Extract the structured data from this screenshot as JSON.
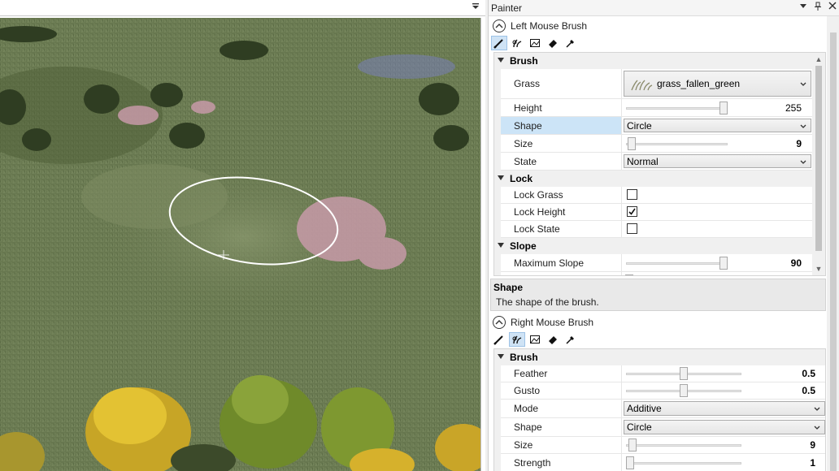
{
  "viewport": {},
  "painter": {
    "title": "Painter",
    "left_brush": {
      "header": "Left Mouse Brush",
      "tools": [
        "paint-brush-icon",
        "grass-brush-icon",
        "texture-icon",
        "eraser-icon",
        "eyedropper-icon"
      ],
      "categories": {
        "brush": "Brush",
        "lock": "Lock",
        "slope": "Slope"
      },
      "props": {
        "grass": {
          "label": "Grass",
          "value": "grass_fallen_green"
        },
        "height": {
          "label": "Height",
          "value": "255",
          "fraction": 1.0
        },
        "shape": {
          "label": "Shape",
          "value": "Circle"
        },
        "size": {
          "label": "Size",
          "value": "9",
          "fraction": 0.02
        },
        "state": {
          "label": "State",
          "value": "Normal"
        },
        "lock_grass": {
          "label": "Lock Grass",
          "checked": false
        },
        "lock_height": {
          "label": "Lock Height",
          "checked": true
        },
        "lock_state": {
          "label": "Lock State",
          "checked": false
        },
        "max_slope": {
          "label": "Maximum Slope",
          "value": "90",
          "fraction": 1.0
        }
      }
    },
    "description": {
      "title": "Shape",
      "text": "The shape of the brush."
    },
    "right_brush": {
      "header": "Right Mouse Brush",
      "category": "Brush",
      "props": {
        "feather": {
          "label": "Feather",
          "value": "0.5",
          "fraction": 0.5
        },
        "gusto": {
          "label": "Gusto",
          "value": "0.5",
          "fraction": 0.5
        },
        "mode": {
          "label": "Mode",
          "value": "Additive"
        },
        "shape": {
          "label": "Shape",
          "value": "Circle"
        },
        "size": {
          "label": "Size",
          "value": "9",
          "fraction": 0.02
        },
        "strength": {
          "label": "Strength",
          "value": "1",
          "fraction": 0.0
        }
      }
    }
  }
}
